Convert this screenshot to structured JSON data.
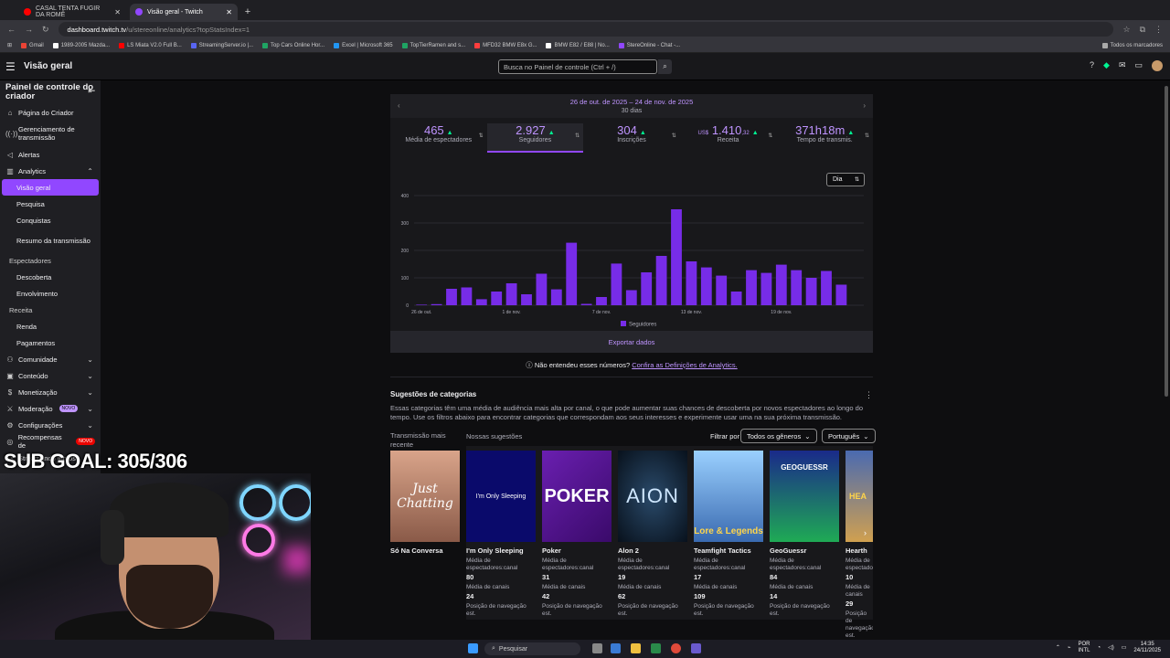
{
  "browser": {
    "tabs": [
      {
        "label": "CASAL TENTA FUGIR DA ROMÊ",
        "color": "#ff0000"
      },
      {
        "label": "Visão geral - Twitch",
        "color": "#9147ff"
      }
    ],
    "url_host": "dashboard.twitch.tv",
    "url_path": "/u/stereonline/analytics?topStatsIndex=1",
    "bookmarks": [
      {
        "label": "Gmail",
        "color": "#ea4335"
      },
      {
        "label": "1989-2005 Mazda...",
        "color": "#ffffff"
      },
      {
        "label": "LS Miata V2.0 Full B...",
        "color": "#ff0000"
      },
      {
        "label": "StreamingServer.io |...",
        "color": "#5865f2"
      },
      {
        "label": "Top Cars Online Hor...",
        "color": "#1fa463"
      },
      {
        "label": "Excel | Microsoft 365",
        "color": "#2196f3"
      },
      {
        "label": "TopTierRamen and s...",
        "color": "#1fa463"
      },
      {
        "label": "MFD32 BMW E8x G...",
        "color": "#ff3d3d"
      },
      {
        "label": "BMW E82 / E88 | No...",
        "color": "#ffffff"
      },
      {
        "label": "StereOnline - Chat -...",
        "color": "#9147ff"
      }
    ],
    "all_bookmarks": "Todos os marcadores"
  },
  "topnav": {
    "title": "Visão geral",
    "search_placeholder": "Busca no Painel de controle (Ctrl + /)"
  },
  "sidebar": {
    "header": "Painel de controle do criador",
    "items": [
      {
        "label": "Página do Criador",
        "icon": "home-icon"
      },
      {
        "label": "Gerenciamento de transmissão",
        "icon": "broadcast-icon"
      },
      {
        "label": "Alertas",
        "icon": "alert-icon"
      },
      {
        "label": "Analytics",
        "icon": "analytics-icon"
      }
    ],
    "analytics_sub": [
      "Visão geral",
      "Pesquisa",
      "Conquistas",
      "Resumo da transmissão"
    ],
    "group_viewers": "Espectadores",
    "viewers_sub": [
      "Descoberta",
      "Envolvimento"
    ],
    "group_revenue": "Receita",
    "revenue_sub": [
      "Renda",
      "Pagamentos"
    ],
    "bottom_items": [
      {
        "label": "Comunidade",
        "icon": "community-icon"
      },
      {
        "label": "Conteúdo",
        "icon": "content-icon"
      },
      {
        "label": "Monetização",
        "icon": "money-icon"
      },
      {
        "label": "Moderação",
        "icon": "moderation-icon",
        "badge": "NOVO"
      },
      {
        "label": "Configurações",
        "icon": "settings-icon"
      }
    ],
    "rewards_label": "Recompensas de",
    "rewards_badge": "NOVO",
    "streaming_together": "Streamando juntos"
  },
  "analytics": {
    "date_range": "26 de out. de 2025 – 24 de nov. de 2025",
    "days": "30 dias",
    "stats": [
      {
        "value": "465",
        "label": "Média de espectadores"
      },
      {
        "value": "2.927",
        "label": "Seguidores"
      },
      {
        "value": "304",
        "label": "Inscrições"
      },
      {
        "prefix": "US$",
        "value": "1.410",
        "suffix": ",32",
        "label": "Receita"
      },
      {
        "value": "371h18m",
        "label": "Tempo de transmis."
      }
    ],
    "period_select": "Dia",
    "export": "Exportar dados",
    "help_text": "Não entendeu esses números?",
    "help_link": "Confira as Definições de Analytics."
  },
  "chart_data": {
    "type": "bar",
    "categories": [
      "26 de out.",
      "27 de out.",
      "28 de out.",
      "29 de out.",
      "30 de out.",
      "31 de out.",
      "1 de nov.",
      "2 de nov.",
      "3 de nov.",
      "4 de nov.",
      "5 de nov.",
      "6 de nov.",
      "7 de nov.",
      "8 de nov.",
      "9 de nov.",
      "10 de nov.",
      "11 de nov.",
      "12 de nov.",
      "13 de nov.",
      "14 de nov.",
      "15 de nov.",
      "16 de nov.",
      "17 de nov.",
      "18 de nov.",
      "19 de nov.",
      "20 de nov.",
      "21 de nov.",
      "22 de nov.",
      "23 de nov.",
      "24 de nov."
    ],
    "x_ticks": [
      "26 de out.",
      "1 de nov.",
      "7 de nov.",
      "13 de nov.",
      "19 de nov."
    ],
    "series": [
      {
        "name": "Seguidores",
        "values": [
          2,
          4,
          60,
          65,
          22,
          50,
          80,
          40,
          115,
          58,
          228,
          5,
          30,
          152,
          55,
          120,
          180,
          350,
          160,
          138,
          108,
          50,
          128,
          118,
          148,
          128,
          100,
          125,
          75,
          0
        ]
      }
    ],
    "y_ticks": [
      0,
      100,
      200,
      300,
      400
    ],
    "ylim": [
      0,
      400
    ],
    "grid": true,
    "color": "#772ce8"
  },
  "suggestions": {
    "title": "Sugestões de categorias",
    "description": "Essas categorias têm uma média de audiência mais alta por canal, o que pode aumentar suas chances de descoberta por novos espectadores ao longo do tempo. Use os filtros abaixo para encontrar categorias que correspondam aos seus interesses e experimente usar uma na sua próxima transmissão.",
    "recent_label": "Transmissão mais recente",
    "ours_label": "Nossas sugestões",
    "filter_label": "Filtrar por",
    "filter_genre": "Todos os gêneros",
    "filter_lang": "Português",
    "recent_card": {
      "name": "Só Na Conversa",
      "art_text": "Just Chatting"
    },
    "meta_viewers": "Média de espectadores:canal",
    "meta_channels": "Média de canais",
    "meta_position": "Posição de navegação est.",
    "cards": [
      {
        "name": "I'm Only Sleeping",
        "art_text": "I'm Only Sleeping",
        "viewers": "80",
        "channels": "24"
      },
      {
        "name": "Poker",
        "art_text": "POKER",
        "viewers": "31",
        "channels": "42"
      },
      {
        "name": "Alon 2",
        "art_text": "AION",
        "viewers": "19",
        "channels": "62"
      },
      {
        "name": "Teamfight Tactics",
        "art_text": "Lore & Legends",
        "viewers": "17",
        "channels": "109"
      },
      {
        "name": "GeoGuessr",
        "art_text": "GEOGUESSR",
        "viewers": "84",
        "channels": "14"
      },
      {
        "name": "Hearth",
        "art_text": "HEA",
        "viewers": "10",
        "channels": "29"
      }
    ]
  },
  "overlay": {
    "sub_goal": "SUB GOAL: 305/306"
  },
  "taskbar": {
    "search": "Pesquisar",
    "lang": "POR",
    "lang2": "INTL",
    "time": "14:35",
    "date": "24/11/2025"
  }
}
